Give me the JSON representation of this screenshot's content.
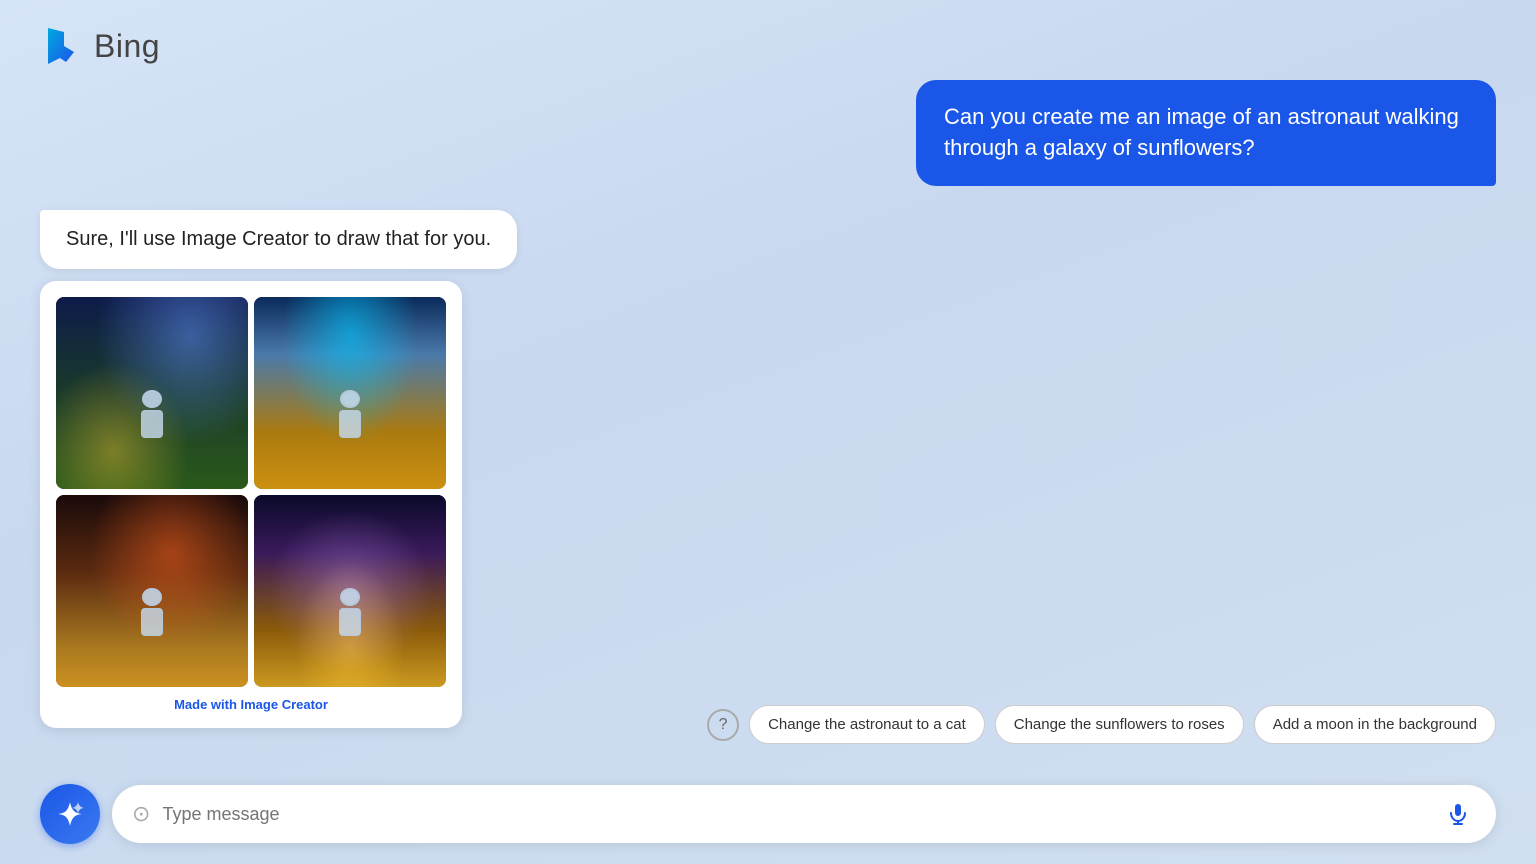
{
  "header": {
    "logo_text": "Bing"
  },
  "user_message": {
    "text": "Can you create me an image of an astronaut walking through a galaxy of sunflowers?"
  },
  "assistant_message": {
    "text": "Sure, I'll use Image Creator to draw that for you."
  },
  "image_grid": {
    "made_with_label": "Made with ",
    "made_with_link": "Image Creator"
  },
  "suggestions": {
    "help_label": "?",
    "chips": [
      {
        "id": "chip-1",
        "label": "Change the astronaut to a cat"
      },
      {
        "id": "chip-2",
        "label": "Change the sunflowers to roses"
      },
      {
        "id": "chip-3",
        "label": "Add a moon in the background"
      }
    ]
  },
  "input": {
    "placeholder": "Type message"
  },
  "buttons": {
    "chat_action": "sparkle"
  }
}
